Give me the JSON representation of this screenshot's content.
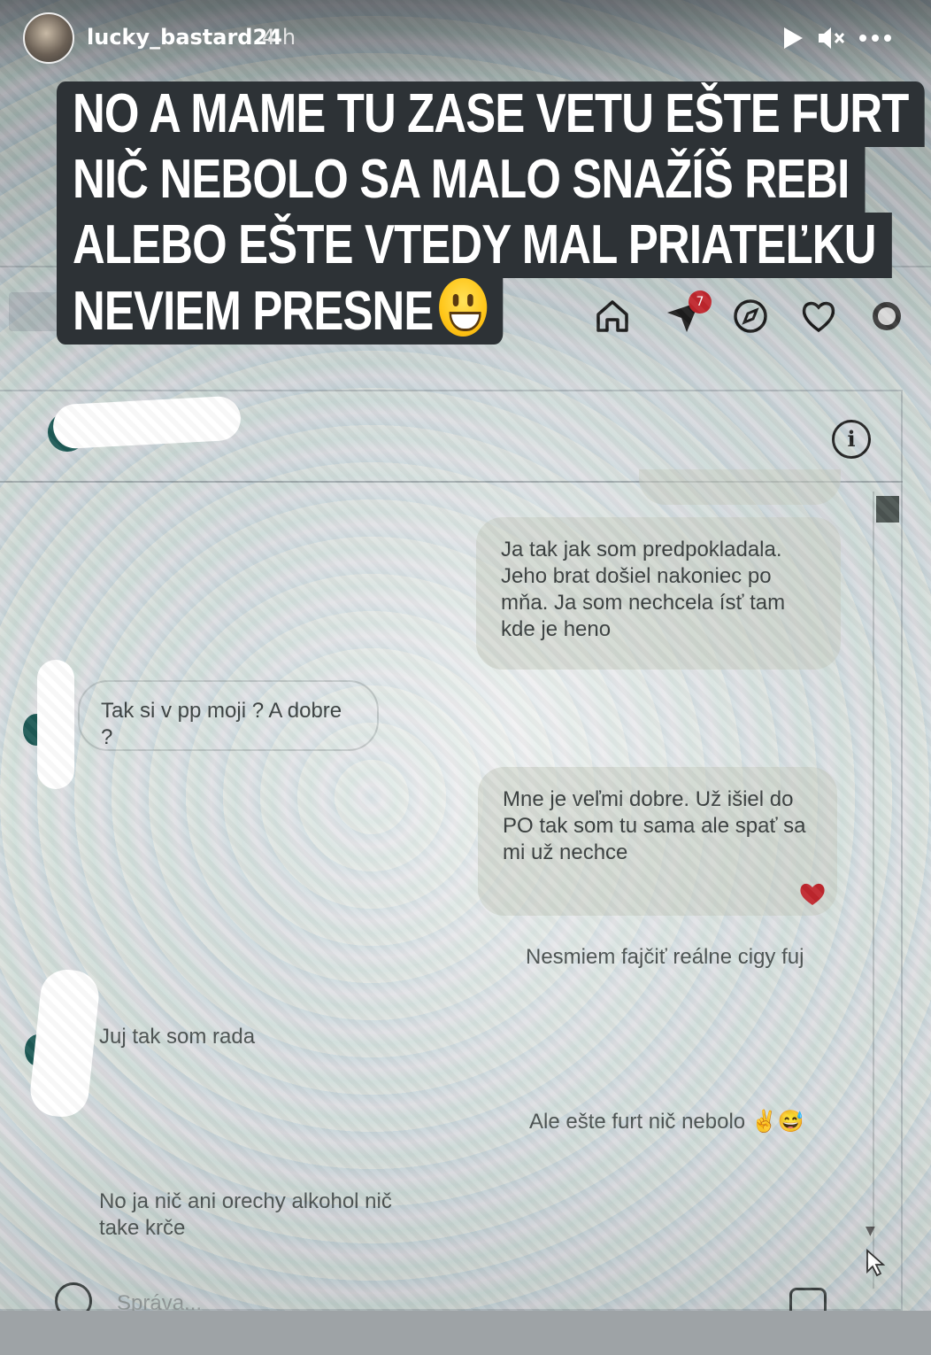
{
  "story": {
    "username": "lucky_bastard24",
    "timestamp": "4 h",
    "play_icon": "play-icon",
    "mute_icon": "mute-icon",
    "more_icon": "more-icon"
  },
  "caption": {
    "lines": [
      "NO A MAME TU ZASE VETU EŠTE FURT",
      "NIČ NEBOLO SA MALO SNAŽÍŠ REBI",
      "ALEBO EŠTE VTEDY MAL PRIATEĽKU",
      "NEVIEM PRESNE"
    ],
    "emoji": "grinning-face"
  },
  "instagram_nav": {
    "icons": [
      "home-icon",
      "direct-icon",
      "explore-icon",
      "heart-icon",
      "profile-icon"
    ],
    "direct_badge": "7"
  },
  "messages": [
    {
      "side": "out",
      "text": "Ja tak jak som predpokladala.\nJeho brat došiel nakoniec po\nmňa. Ja som nechcela ísť tam\nkde je heno"
    },
    {
      "side": "in",
      "text": "Tak si v pp moji ? A dobre ?"
    },
    {
      "side": "out",
      "text": "Mne je veľmi dobre. Už išiel do\nPO tak som tu sama ale spať sa\nmi už nechce",
      "reaction": "heart"
    },
    {
      "side": "out",
      "text": "Nesmiem fajčiť reálne cigy fuj"
    },
    {
      "side": "in",
      "text": "Juj tak som rada"
    },
    {
      "side": "out",
      "text": "Ale ešte furt nič nebolo ✌😅"
    },
    {
      "side": "in",
      "text": "No ja nič ani orechy alkohol nič\ntake krče"
    }
  ],
  "composer": {
    "placeholder": "Správa..."
  },
  "colors": {
    "caption_bg": "#2d3236",
    "badge": "#c0262d",
    "reaction_heart": "#c0262d"
  }
}
